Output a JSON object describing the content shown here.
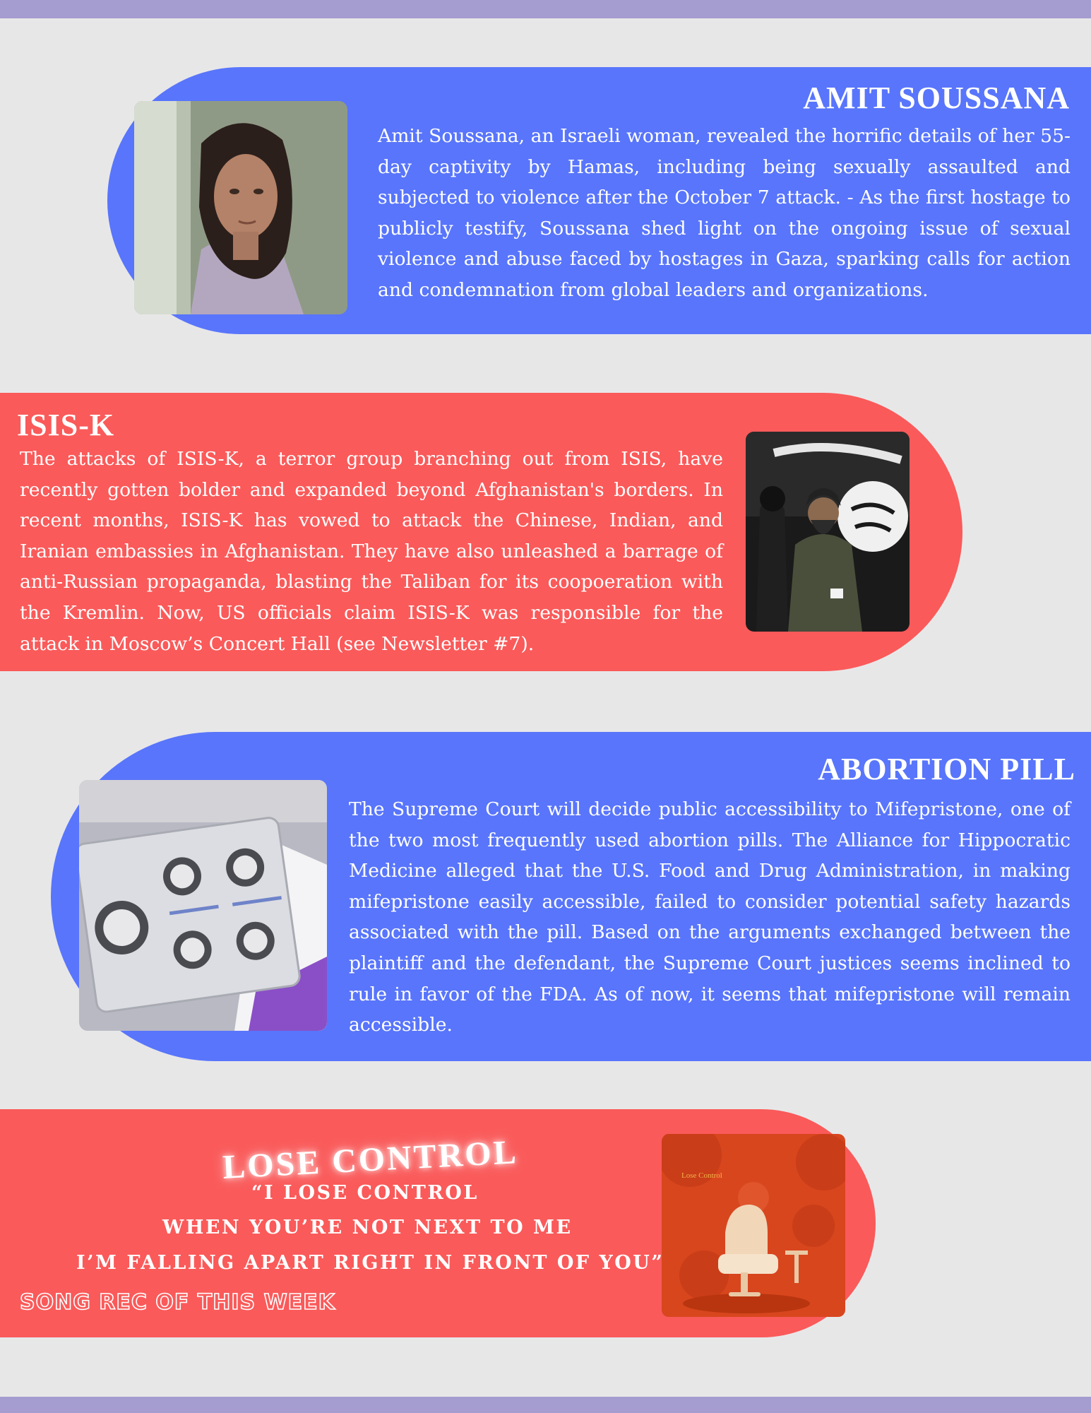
{
  "colors": {
    "background": "#e8e7e8",
    "accent_bar": "#a59ccf",
    "card_blue": "#5875fb",
    "card_red": "#fa5a5a"
  },
  "stories": [
    {
      "title": "AMIT SOUSSANA",
      "body": "Amit Soussana, an Israeli woman, revealed the horrific details of her 55-day captivity by Hamas, including being sexually assaulted and subjected to violence after the October 7 attack. - As the first hostage to publicly testify, Soussana shed light on the ongoing issue of sexual violence and abuse faced by hostages in Gaza, sparking calls for action and condemnation from global leaders and organizations."
    },
    {
      "title": "ISIS-K",
      "body": "The attacks of ISIS-K, a terror group branching out from ISIS, have recently gotten bolder and expanded beyond Afghanistan's borders. In recent months, ISIS-K has vowed to attack the Chinese, Indian, and Iranian embassies in Afghanistan. They have also unleashed a barrage of anti-Russian propaganda, blasting the Taliban for its coopoeration with the Kremlin. Now, US officials claim ISIS-K was responsible for the attack in Moscow’s Concert Hall (see Newsletter #7)."
    },
    {
      "title": "ABORTION PILL",
      "body": "The Supreme Court will decide public accessibility to Mifepristone, one of the two most frequently used abortion pills. The Alliance for Hippocratic Medicine alleged that the U.S. Food and Drug Administration, in making mifepristone easily accessible, failed to consider potential safety hazards associated with the pill. Based on the arguments exchanged between the plaintiff and the defendant, the Supreme Court justices seems inclined to rule in favor of the FDA. As of now, it seems that mifepristone will remain accessible."
    }
  ],
  "song": {
    "heading": "LOSE CONTROL",
    "lyrics": [
      "“I LOSE CONTROL",
      "WHEN YOU’RE NOT NEXT TO ME",
      "I’M FALLING APART RIGHT IN FRONT OF YOU”"
    ],
    "rec_label": "SONG REC OF THIS WEEK",
    "album_text": "Lose Control"
  }
}
